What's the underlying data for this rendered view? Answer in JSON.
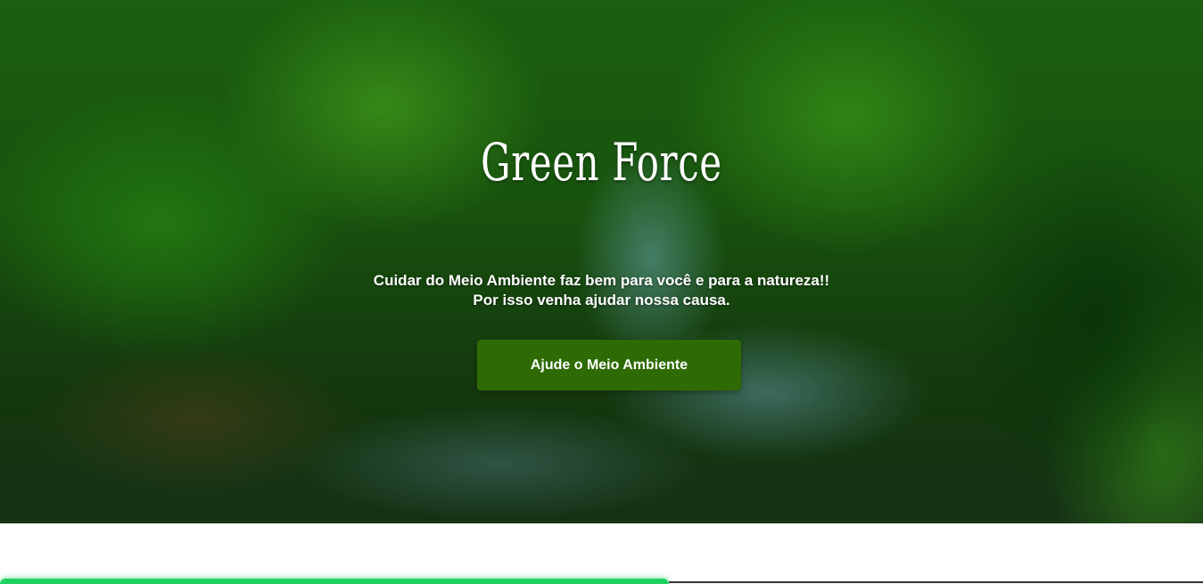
{
  "hero": {
    "title": "Green Force",
    "text_line1": "Cuidar do Meio Ambiente faz bem para você e para a natureza!!",
    "text_line2": "Por isso venha ajudar nossa causa.",
    "button_label": "Ajude o Meio Ambiente"
  },
  "colors": {
    "button_bg": "#2e6b04",
    "accent_strip": "#1fd25f",
    "text": "#ffffff"
  }
}
